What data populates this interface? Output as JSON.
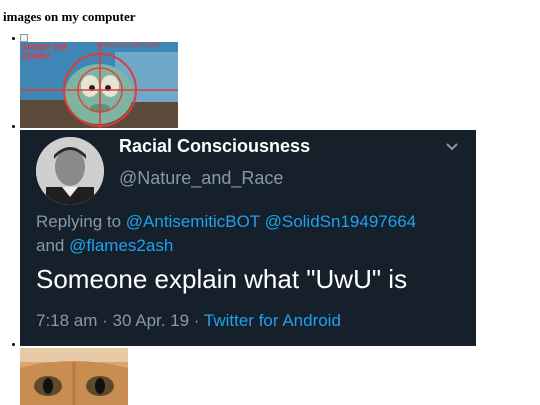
{
  "page": {
    "title": "images on my computer"
  },
  "images": [
    {
      "type": "broken-image"
    },
    {
      "type": "meme",
      "caption_left": "SHOOT E'M\nDOWN!",
      "caption_right": "WWW.ILR.COM ©1907",
      "colors": {
        "background": "#2c6d9a",
        "crosshair": "#e53935"
      }
    },
    {
      "type": "tweet-screenshot"
    },
    {
      "type": "cat-photo",
      "colors": {
        "fur": "#d9a570"
      }
    }
  ],
  "tweet": {
    "display_name": "Racial Consciousness",
    "handle": "@Nature_and_Race",
    "replying_prefix": "Replying to ",
    "replying_mentions": [
      "@AntisemiticBOT",
      "@SolidSn19497664"
    ],
    "replying_and": "and ",
    "replying_last": "@flames2ash",
    "text": "Someone explain what \"UwU\" is",
    "time": "7:18 am · 30 Apr. 19 · ",
    "source": "Twitter for Android",
    "colors": {
      "background": "#15202b",
      "link": "#1da1f2",
      "muted": "#8899a6"
    }
  }
}
